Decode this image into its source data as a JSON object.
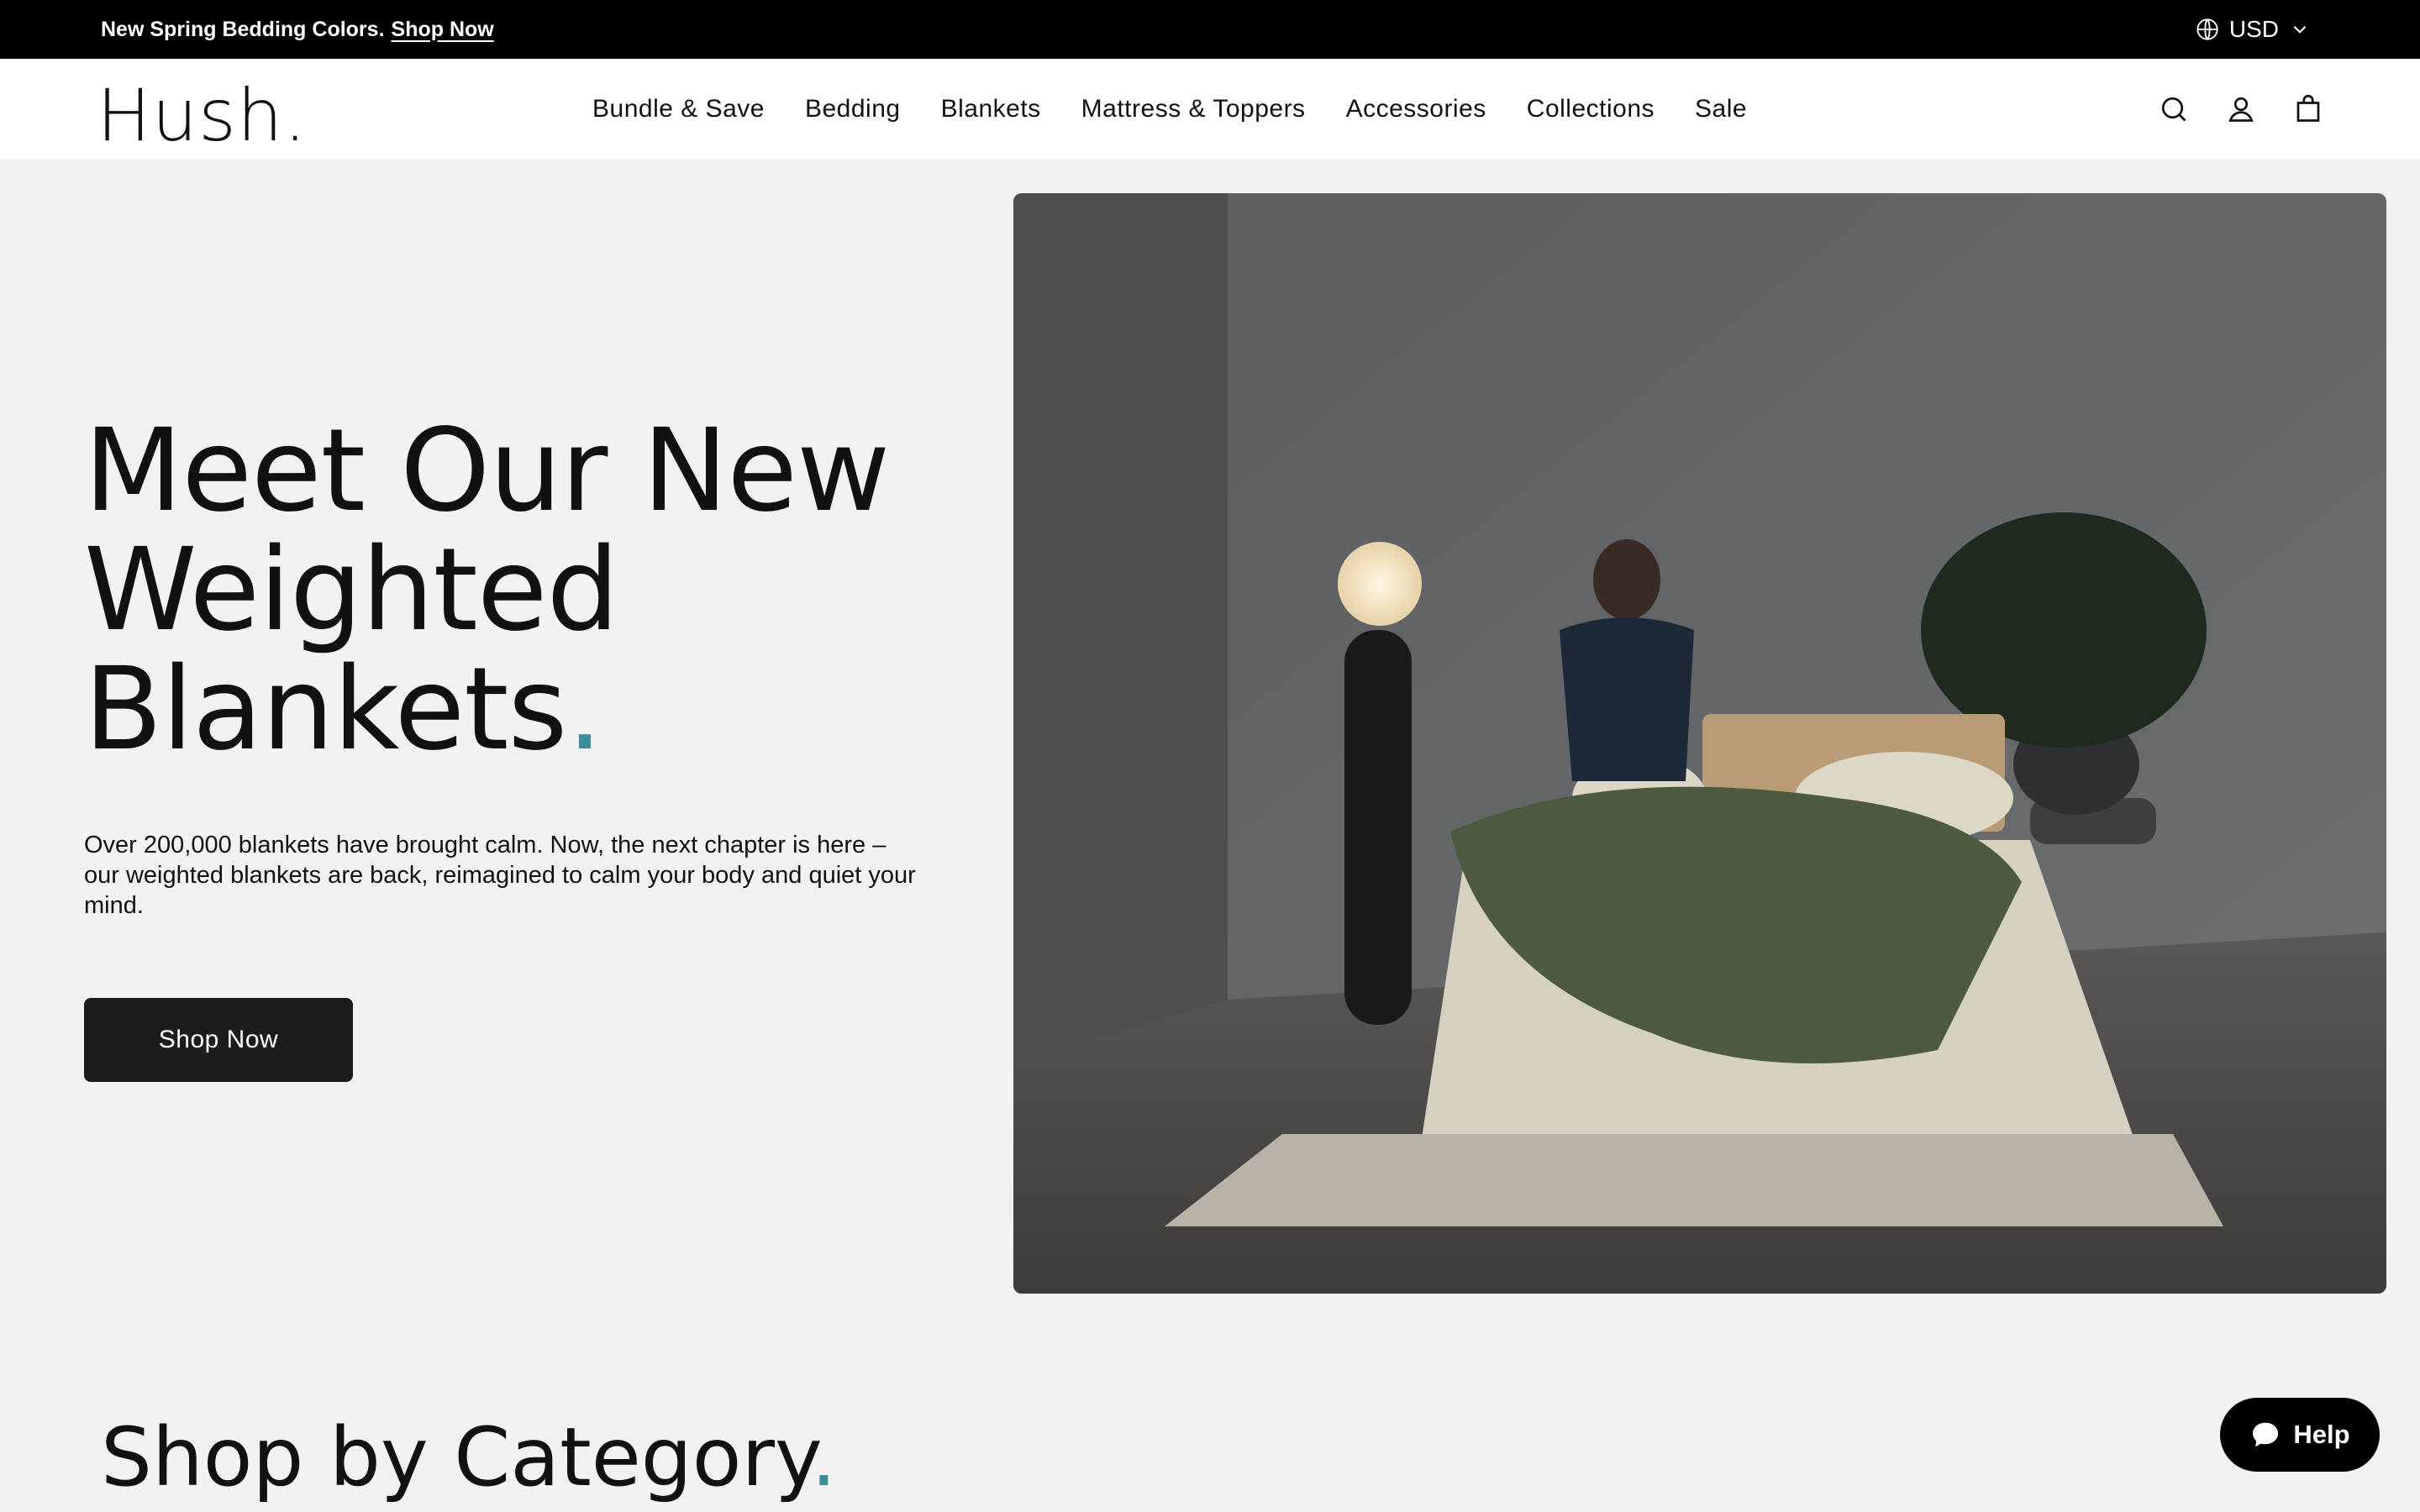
{
  "announcement": {
    "text": "New Spring Bedding Colors.",
    "link": "Shop Now",
    "currency": "USD",
    "globe_icon": "globe-icon",
    "chevron_icon": "chevron-down-icon"
  },
  "header": {
    "logo": "Hush.",
    "nav": [
      "Bundle & Save",
      "Bedding",
      "Blankets",
      "Mattress & Toppers",
      "Accessories",
      "Collections",
      "Sale"
    ],
    "icons": [
      "search-icon",
      "account-icon",
      "cart-icon"
    ]
  },
  "hero": {
    "title_line1": "Meet Our New",
    "title_line2": "Weighted",
    "title_line3": "Blankets",
    "title_dot": ".",
    "description": "Over 200,000 blankets have brought calm. Now, the next chapter is here – our weighted blankets are back, reimagined to calm your body and quiet your mind.",
    "cta": "Shop Now"
  },
  "section": {
    "title": "Shop by Category",
    "title_dot": "."
  },
  "help": {
    "label": "Help",
    "icon": "chat-bubble-icon"
  },
  "colors": {
    "accent": "#3a8e9a",
    "topbar": "#000000",
    "button": "#1c1c1c",
    "page_bg": "#f2f2f2"
  }
}
